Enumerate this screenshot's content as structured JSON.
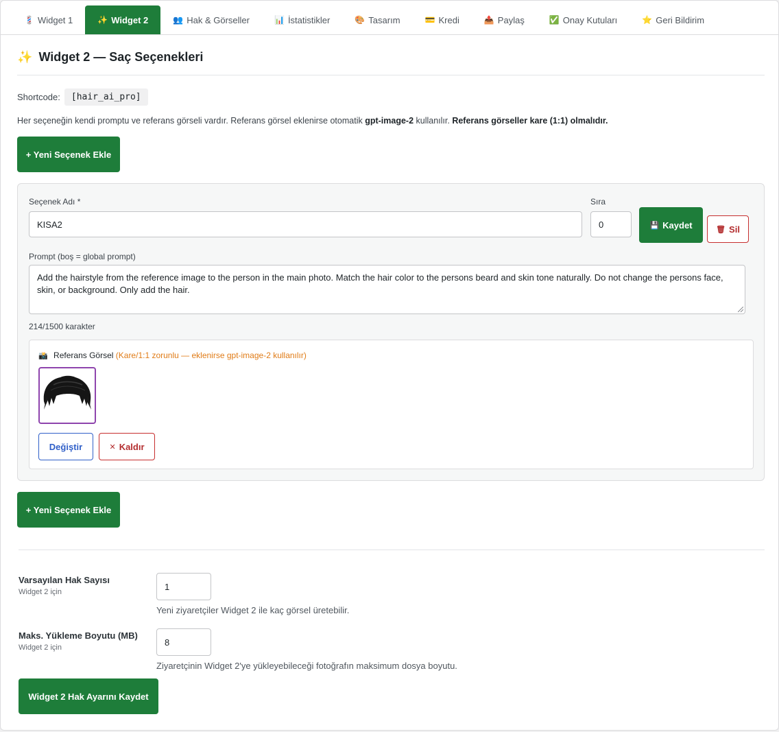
{
  "tabs": [
    {
      "icon": "💈",
      "label": "Widget 1",
      "active": false
    },
    {
      "icon": "✨",
      "label": "Widget 2",
      "active": true
    },
    {
      "icon": "👥",
      "label": "Hak & Görseller",
      "active": false
    },
    {
      "icon": "📊",
      "label": "İstatistikler",
      "active": false
    },
    {
      "icon": "🎨",
      "label": "Tasarım",
      "active": false
    },
    {
      "icon": "💳",
      "label": "Kredi",
      "active": false
    },
    {
      "icon": "📤",
      "label": "Paylaş",
      "active": false
    },
    {
      "icon": "✅",
      "label": "Onay Kutuları",
      "active": false
    },
    {
      "icon": "⭐",
      "label": "Geri Bildirim",
      "active": false
    }
  ],
  "header": {
    "icon": "✨",
    "title": "Widget 2 — Saç Seçenekleri"
  },
  "shortcode": {
    "label": "Shortcode:",
    "value": "[hair_ai_pro]"
  },
  "description": {
    "part1": "Her seçeneğin kendi promptu ve referans görseli vardır. Referans görsel eklenirse otomatik ",
    "bold1": "gpt-image-2",
    "part2": " kullanılır. ",
    "bold2": "Referans görseller kare (1:1) olmalıdır."
  },
  "add_option_label": "+ Yeni Seçenek Ekle",
  "option": {
    "name_label": "Seçenek Adı *",
    "name_value": "KISA2",
    "order_label": "Sıra",
    "order_value": "0",
    "save_icon": "💾",
    "save_label": "Kaydet",
    "delete_icon": "🗑",
    "delete_label": "Sil",
    "prompt_label": "Prompt (boş = global prompt)",
    "prompt_value": "Add the hairstyle from the reference image to the person in the main photo. Match the hair color to the persons beard and skin tone naturally. Do not change the persons face, skin, or background. Only add the hair.",
    "char_count": "214/1500 karakter",
    "reference": {
      "icon": "📸",
      "title": "Referans Görsel",
      "note": "(Kare/1:1 zorunlu — eklenirse gpt-image-2 kullanılır)",
      "change_label": "Değiştir",
      "remove_icon": "✕",
      "remove_label": "Kaldır"
    }
  },
  "settings": {
    "default_rights_label": "Varsayılan Hak Sayısı",
    "default_rights_sub": "Widget 2 için",
    "default_rights_value": "1",
    "default_rights_help": "Yeni ziyaretçiler Widget 2 ile kaç görsel üretebilir.",
    "max_upload_label": "Maks. Yükleme Boyutu (MB)",
    "max_upload_sub": "Widget 2 için",
    "max_upload_value": "8",
    "max_upload_help": "Ziyaretçinin Widget 2'ye yükleyebileceği fotoğrafın maksimum dosya boyutu.",
    "save_label": "Widget 2 Hak Ayarını Kaydet"
  },
  "colors": {
    "accent_green": "#1e7d3a",
    "danger_red": "#b32d2e",
    "link_blue": "#2f5fc8",
    "note_orange": "#e07b16",
    "thumb_border": "#8e44ad"
  }
}
